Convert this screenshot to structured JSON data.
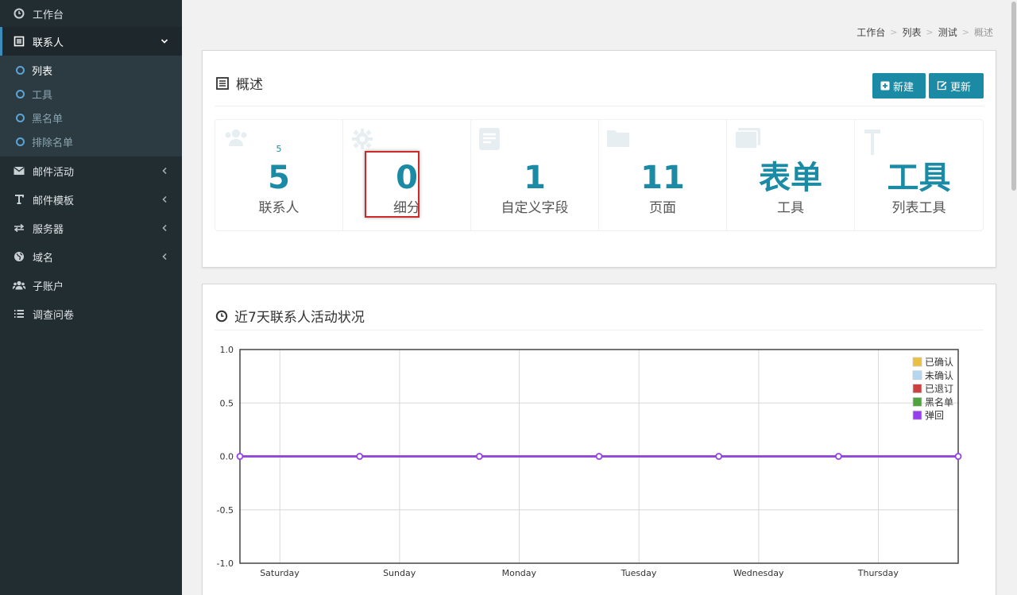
{
  "sidebar": {
    "items": [
      {
        "label": "工作台",
        "icon": "dashboard-icon"
      },
      {
        "label": "联系人",
        "icon": "list-icon",
        "active": true,
        "caret": "chevron-down-icon"
      },
      {
        "label": "邮件活动",
        "icon": "envelope-icon",
        "caret": "chevron-left-icon"
      },
      {
        "label": "邮件模板",
        "icon": "text-icon",
        "caret": "chevron-left-icon"
      },
      {
        "label": "服务器",
        "icon": "exchange-icon",
        "caret": "chevron-left-icon"
      },
      {
        "label": "域名",
        "icon": "globe-icon",
        "caret": "chevron-left-icon"
      },
      {
        "label": "子账户",
        "icon": "users-icon"
      },
      {
        "label": "调查问卷",
        "icon": "bars-icon"
      }
    ],
    "submenu": [
      "列表",
      "工具",
      "黑名单",
      "排除名单"
    ]
  },
  "breadcrumb": [
    "工作台",
    "列表",
    "测试",
    "概述"
  ],
  "overview": {
    "title": "概述",
    "new_button": "新建",
    "update_button": "更新",
    "stats": [
      {
        "small": "5",
        "value": "5",
        "label": "联系人",
        "icon": "users-icon"
      },
      {
        "small": "",
        "value": "0",
        "label": "细分",
        "icon": "gear-icon"
      },
      {
        "small": "",
        "value": "1",
        "label": "自定义字段",
        "icon": "file-icon"
      },
      {
        "small": "",
        "value": "11",
        "label": "页面",
        "icon": "folder-icon"
      },
      {
        "small": "",
        "value": "表单",
        "label": "工具",
        "icon": "window-icon"
      },
      {
        "small": "",
        "value": "工具",
        "label": "列表工具",
        "icon": "hammer-icon"
      }
    ]
  },
  "activity": {
    "title": "近7天联系人活动状况"
  },
  "chart_data": {
    "type": "line",
    "title": "",
    "xlabel": "",
    "ylabel": "",
    "x": [
      "Saturday",
      "Sunday",
      "Monday",
      "Tuesday",
      "Wednesday",
      "Thursday",
      ""
    ],
    "ylim": [
      -1.0,
      1.0
    ],
    "yticks": [
      "1.0",
      "0.5",
      "0.0",
      "-0.5",
      "-1.0"
    ],
    "grid": true,
    "legend": "top-right",
    "series": [
      {
        "name": "已确认",
        "color": "#e8c142",
        "values": [
          0,
          0,
          0,
          0,
          0,
          0,
          0
        ]
      },
      {
        "name": "未确认",
        "color": "#b3d6f2",
        "values": [
          0,
          0,
          0,
          0,
          0,
          0,
          0
        ]
      },
      {
        "name": "已退订",
        "color": "#c9423f",
        "values": [
          0,
          0,
          0,
          0,
          0,
          0,
          0
        ]
      },
      {
        "name": "黑名单",
        "color": "#4ea43c",
        "values": [
          0,
          0,
          0,
          0,
          0,
          0,
          0
        ]
      },
      {
        "name": "弹回",
        "color": "#9440ed",
        "values": [
          0,
          0,
          0,
          0,
          0,
          0,
          0
        ]
      }
    ]
  }
}
